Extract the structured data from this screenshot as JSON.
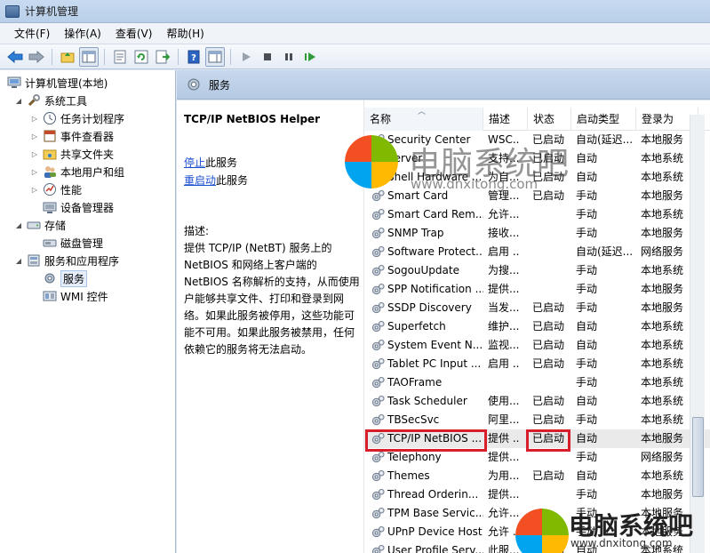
{
  "window": {
    "title": "计算机管理"
  },
  "menu": [
    "文件(F)",
    "操作(A)",
    "查看(V)",
    "帮助(H)"
  ],
  "toolbar_icons": [
    "back-icon",
    "forward-icon",
    "up-folder-icon",
    "show-tree-icon",
    "properties-icon",
    "refresh-icon",
    "export-icon",
    "help-icon",
    "action-pane-icon",
    "play-icon",
    "stop-icon",
    "pause-icon",
    "resume-icon"
  ],
  "tree": [
    {
      "label": "计算机管理(本地)",
      "icon": "computer-management-icon"
    },
    {
      "label": "系统工具",
      "icon": "system-tools-icon"
    },
    {
      "label": "任务计划程序",
      "icon": "task-scheduler-icon"
    },
    {
      "label": "事件查看器",
      "icon": "event-viewer-icon"
    },
    {
      "label": "共享文件夹",
      "icon": "shared-folders-icon"
    },
    {
      "label": "本地用户和组",
      "icon": "users-groups-icon"
    },
    {
      "label": "性能",
      "icon": "performance-icon"
    },
    {
      "label": "设备管理器",
      "icon": "device-manager-icon"
    },
    {
      "label": "存储",
      "icon": "storage-icon"
    },
    {
      "label": "磁盘管理",
      "icon": "disk-management-icon"
    },
    {
      "label": "服务和应用程序",
      "icon": "services-apps-icon"
    },
    {
      "label": "服务",
      "icon": "services-icon"
    },
    {
      "label": "WMI 控件",
      "icon": "wmi-icon"
    }
  ],
  "panel_title": "服务",
  "details": {
    "service_name": "TCP/IP NetBIOS Helper",
    "stop_link": "停止",
    "stop_suffix": "此服务",
    "restart_link": "重启动",
    "restart_suffix": "此服务",
    "desc_label": "描述:",
    "description": "提供 TCP/IP (NetBT) 服务上的 NetBIOS 和网络上客户端的 NetBIOS 名称解析的支持，从而使用户能够共享文件、打印和登录到网络。如果此服务被停用，这些功能可能不可用。如果此服务被禁用，任何依赖它的服务将无法启动。"
  },
  "columns": [
    "名称",
    "描述",
    "状态",
    "启动类型",
    "登录为"
  ],
  "services": [
    {
      "name": "Security Center",
      "desc": "WSC...",
      "status": "已启动",
      "startup": "自动(延迟...",
      "logon": "本地服务"
    },
    {
      "name": "Server",
      "desc": "支持...",
      "status": "已启动",
      "startup": "自动",
      "logon": "本地系统"
    },
    {
      "name": "Shell Hardware ...",
      "desc": "为自...",
      "status": "已启动",
      "startup": "自动",
      "logon": "本地系统"
    },
    {
      "name": "Smart Card",
      "desc": "管理...",
      "status": "已启动",
      "startup": "手动",
      "logon": "本地服务"
    },
    {
      "name": "Smart Card Rem...",
      "desc": "允许...",
      "status": "",
      "startup": "手动",
      "logon": "本地系统"
    },
    {
      "name": "SNMP Trap",
      "desc": "接收...",
      "status": "",
      "startup": "手动",
      "logon": "本地服务"
    },
    {
      "name": "Software Protect...",
      "desc": "启用 ...",
      "status": "",
      "startup": "自动(延迟...",
      "logon": "网络服务"
    },
    {
      "name": "SogouUpdate",
      "desc": "为搜...",
      "status": "",
      "startup": "手动",
      "logon": "本地系统"
    },
    {
      "name": "SPP Notification ...",
      "desc": "提供...",
      "status": "",
      "startup": "手动",
      "logon": "本地服务"
    },
    {
      "name": "SSDP Discovery",
      "desc": "当发...",
      "status": "已启动",
      "startup": "手动",
      "logon": "本地服务"
    },
    {
      "name": "Superfetch",
      "desc": "维护...",
      "status": "已启动",
      "startup": "自动",
      "logon": "本地系统"
    },
    {
      "name": "System Event N...",
      "desc": "监视...",
      "status": "已启动",
      "startup": "自动",
      "logon": "本地系统"
    },
    {
      "name": "Tablet PC Input ...",
      "desc": "启用 ...",
      "status": "已启动",
      "startup": "手动",
      "logon": "本地系统"
    },
    {
      "name": "TAOFrame",
      "desc": "",
      "status": "",
      "startup": "手动",
      "logon": "本地系统"
    },
    {
      "name": "Task Scheduler",
      "desc": "使用...",
      "status": "已启动",
      "startup": "自动",
      "logon": "本地系统"
    },
    {
      "name": "TBSecSvc",
      "desc": "阿里...",
      "status": "已启动",
      "startup": "手动",
      "logon": "本地系统"
    },
    {
      "name": "TCP/IP NetBIOS ...",
      "desc": "提供 ...",
      "status": "已启动",
      "startup": "自动",
      "logon": "本地服务"
    },
    {
      "name": "Telephony",
      "desc": "提供...",
      "status": "",
      "startup": "手动",
      "logon": "网络服务"
    },
    {
      "name": "Themes",
      "desc": "为用...",
      "status": "已启动",
      "startup": "自动",
      "logon": "本地系统"
    },
    {
      "name": "Thread Orderin...",
      "desc": "提供...",
      "status": "",
      "startup": "手动",
      "logon": "本地服务"
    },
    {
      "name": "TPM Base Servic...",
      "desc": "允许...",
      "status": "",
      "startup": "手动",
      "logon": "本地服务"
    },
    {
      "name": "UPnP Device Host",
      "desc": "允许 ...",
      "status": "",
      "startup": "手动",
      "logon": "本地服务"
    },
    {
      "name": "User Profile Serv...",
      "desc": "此服...",
      "status": "已启动",
      "startup": "自动",
      "logon": "本地系统"
    }
  ],
  "watermark": {
    "cn": "电脑系统吧",
    "url": "www.dnxitong.com"
  },
  "colors": {
    "highlight_box": "#d81e2b",
    "link": "#1c4fd0",
    "header_band": "#c9d9ec"
  }
}
